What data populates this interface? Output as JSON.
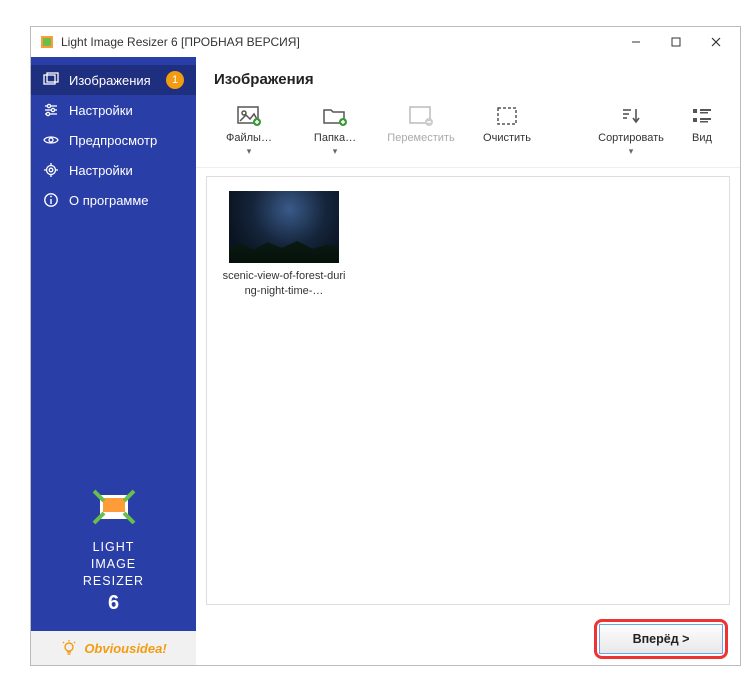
{
  "titlebar": {
    "title": "Light Image Resizer 6  [ПРОБНАЯ ВЕРСИЯ]"
  },
  "sidebar": {
    "items": [
      {
        "label": "Изображения",
        "badge": "1",
        "active": true
      },
      {
        "label": "Настройки"
      },
      {
        "label": "Предпросмотр"
      },
      {
        "label": "Настройки"
      },
      {
        "label": "О программе"
      }
    ],
    "brand_line1": "LIGHT",
    "brand_line2": "IMAGE",
    "brand_line3": "RESIZER",
    "brand_version": "6",
    "footer_brand": "Obviousidea",
    "footer_excl": "!"
  },
  "main": {
    "heading": "Изображения",
    "toolbar": {
      "files": "Файлы…",
      "folder": "Папка…",
      "move": "Переместить",
      "clear": "Очистить",
      "sort": "Сортировать",
      "view": "Вид"
    },
    "thumb_caption": "scenic-view-of-forest-during-night-time-…"
  },
  "actions": {
    "next": "Вперёд >"
  }
}
